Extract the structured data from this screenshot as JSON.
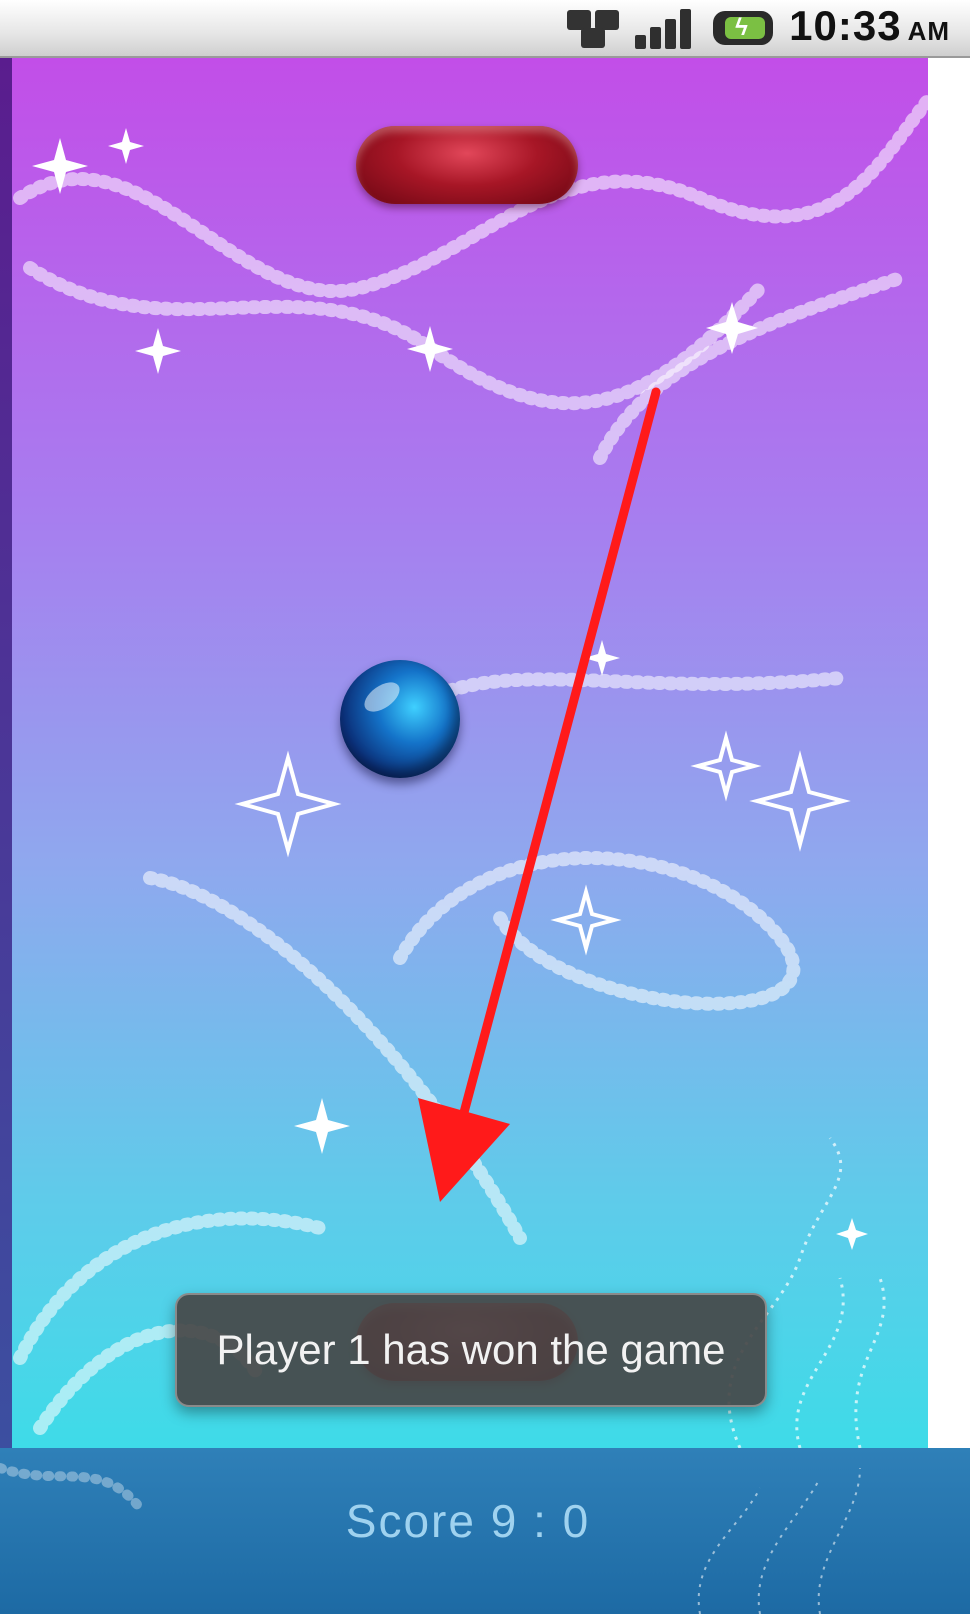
{
  "status_bar": {
    "time": "10:33",
    "ampm": "AM",
    "icons": [
      "network-data-icon",
      "signal-bars-icon",
      "battery-charging-icon"
    ]
  },
  "game": {
    "toast_message": "Player 1 has won the game",
    "score_text": "Score 9 : 0"
  },
  "colors": {
    "background_top": "#c24ee8",
    "background_bottom": "#3edbe8",
    "paddle": "#a71626",
    "ball": "#1473c9",
    "annotation_arrow": "#ff1a1a",
    "score_bar": "#2f80b8"
  }
}
